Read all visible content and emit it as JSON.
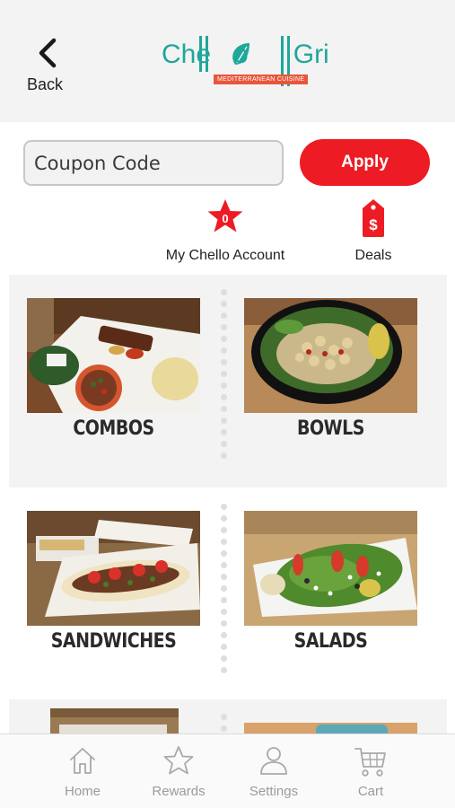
{
  "header": {
    "back_label": "Back",
    "logo_text": "Chello Grill",
    "logo_tagline": "MEDITERRANEAN CUISINE"
  },
  "coupon": {
    "placeholder": "Coupon Code",
    "apply_label": "Apply"
  },
  "quick_links": {
    "account": {
      "label": "My Chello Account",
      "badge": "0",
      "icon": "star-icon"
    },
    "deals": {
      "label": "Deals",
      "icon": "price-tag-icon"
    }
  },
  "categories": [
    {
      "label": "COMBOS",
      "image": "combo-platter-photo"
    },
    {
      "label": "BOWLS",
      "image": "chickpea-bowl-photo"
    },
    {
      "label": "SANDWICHES",
      "image": "flatbread-sandwich-photo"
    },
    {
      "label": "SALADS",
      "image": "green-salad-photo"
    }
  ],
  "tabbar": {
    "home": "Home",
    "rewards": "Rewards",
    "settings": "Settings",
    "cart": "Cart"
  },
  "colors": {
    "accent_red": "#ed1c24",
    "logo_teal": "#1fa79a",
    "tab_inactive": "#9b9b9b"
  }
}
